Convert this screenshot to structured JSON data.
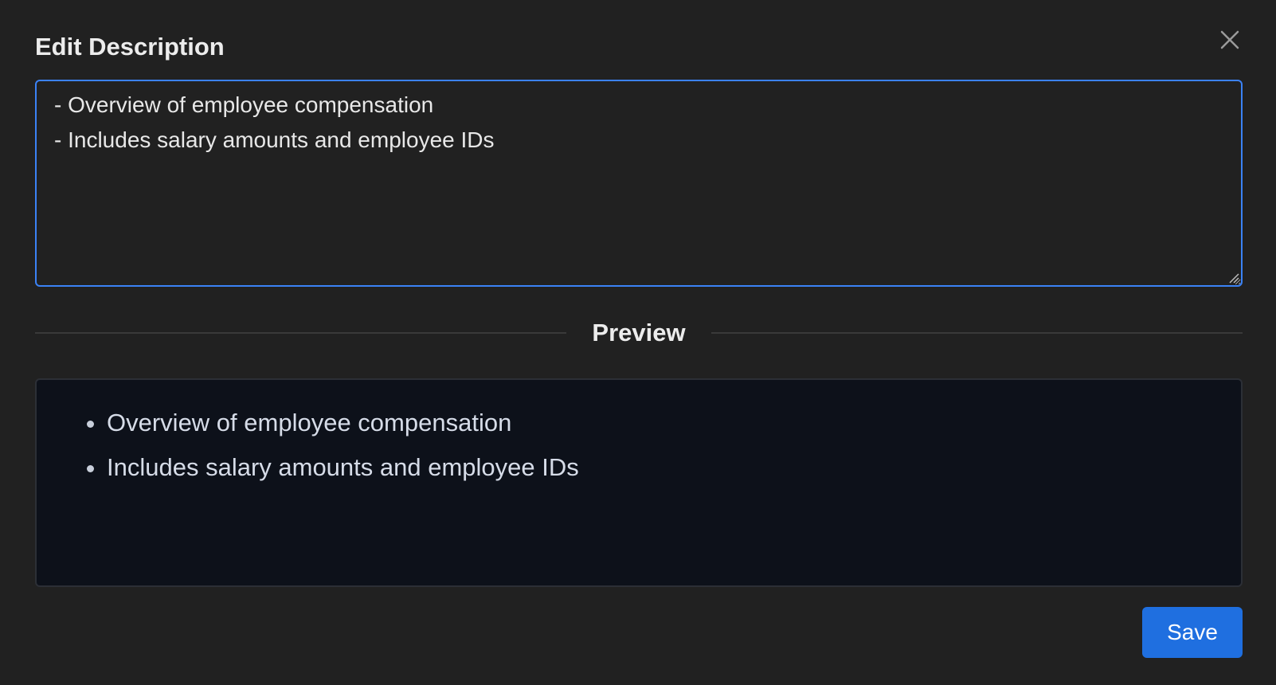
{
  "modal": {
    "title": "Edit Description",
    "close_icon": "close-icon"
  },
  "editor": {
    "value": "- Overview of employee compensation\n- Includes salary amounts and employee IDs"
  },
  "preview": {
    "label": "Preview",
    "items": [
      "Overview of employee compensation",
      "Includes salary amounts and employee IDs"
    ]
  },
  "footer": {
    "save_label": "Save"
  },
  "colors": {
    "background": "#212121",
    "accent": "#3b82f6",
    "save_button": "#1f6fe0",
    "preview_background": "#0d111a"
  }
}
